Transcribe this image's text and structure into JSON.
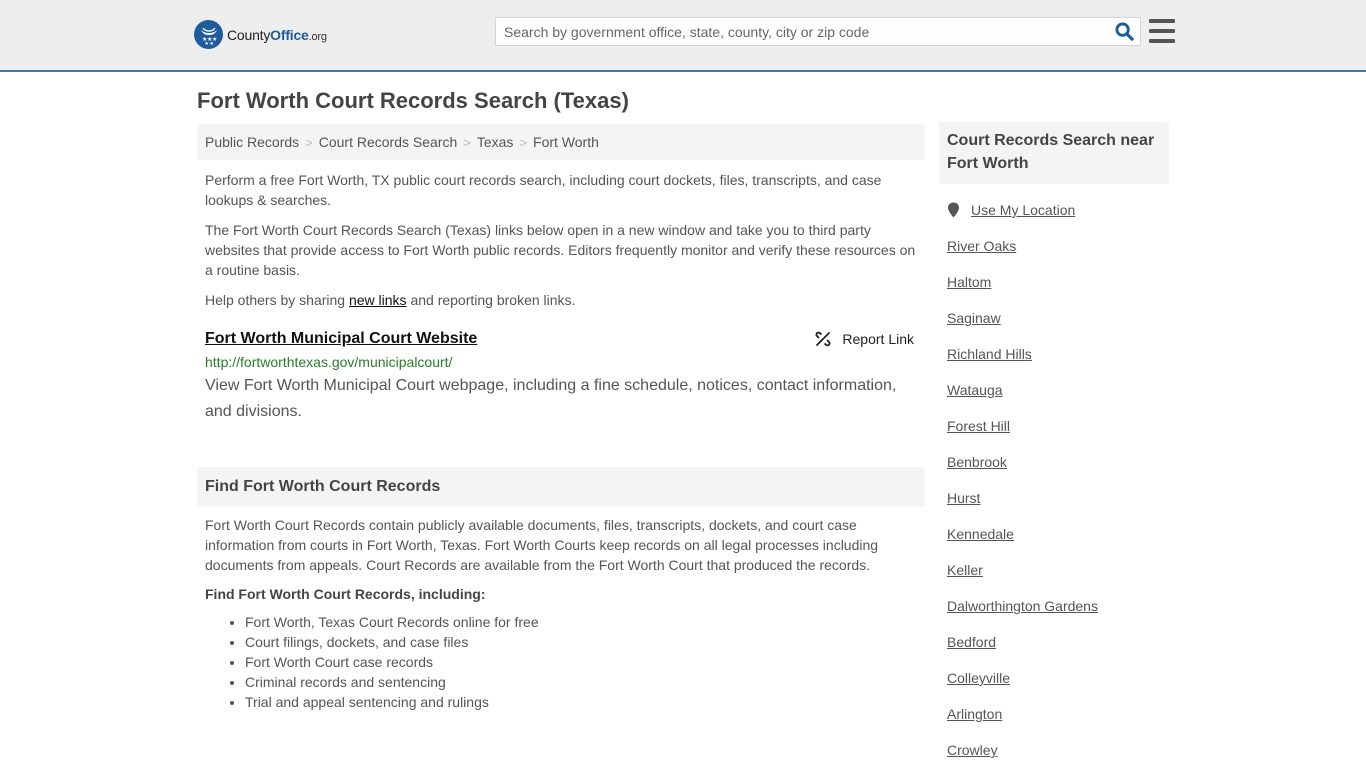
{
  "header": {
    "logo": {
      "name": "County",
      "name_bold": "Office",
      "tld": ".org"
    },
    "search": {
      "placeholder": "Search by government office, state, county, city or zip code",
      "value": ""
    },
    "icons": {
      "search": "search-icon",
      "menu": "hamburger-menu-icon",
      "logo": "eagle-stars-logo-icon"
    },
    "colors": {
      "brand": "#1f5c9e",
      "accent_border": "#337ab7"
    }
  },
  "page": {
    "title": "Fort Worth Court Records Search (Texas)"
  },
  "breadcrumb": [
    {
      "label": "Public Records"
    },
    {
      "label": "Court Records Search"
    },
    {
      "label": "Texas"
    },
    {
      "label": "Fort Worth"
    }
  ],
  "breadcrumb_separator": ">",
  "intro": {
    "p1": "Perform a free Fort Worth, TX public court records search, including court dockets, files, transcripts, and case lookups & searches.",
    "p2": "The Fort Worth Court Records Search (Texas) links below open in a new window and take you to third party websites that provide access to Fort Worth public records. Editors frequently monitor and verify these resources on a routine basis.",
    "p3_before": "Help others by sharing ",
    "p3_link": "new links",
    "p3_after": " and reporting broken links."
  },
  "resource": {
    "title": "Fort Worth Municipal Court Website",
    "url": "http://fortworthtexas.gov/municipalcourt/",
    "description": "View Fort Worth Municipal Court webpage, including a fine schedule, notices, contact information, and divisions.",
    "report_label": "Report Link",
    "report_icon": "broken-link-icon",
    "url_color": "#2a7d2a"
  },
  "find_section": {
    "heading": "Find Fort Worth Court Records",
    "body": "Fort Worth Court Records contain publicly available documents, files, transcripts, dockets, and court case information from courts in Fort Worth, Texas. Fort Worth Courts keep records on all legal processes including documents from appeals. Court Records are available from the Fort Worth Court that produced the records.",
    "subheading": "Find Fort Worth Court Records, including:",
    "bullets": [
      "Fort Worth, Texas Court Records online for free",
      "Court filings, dockets, and case files",
      "Fort Worth Court case records",
      "Criminal records and sentencing",
      "Trial and appeal sentencing and rulings"
    ]
  },
  "sidebar": {
    "heading": "Court Records Search near Fort Worth",
    "use_location": "Use My Location",
    "location_icon": "map-pin-icon",
    "cities": [
      "River Oaks",
      "Haltom",
      "Saginaw",
      "Richland Hills",
      "Watauga",
      "Forest Hill",
      "Benbrook",
      "Hurst",
      "Kennedale",
      "Keller",
      "Dalworthington Gardens",
      "Bedford",
      "Colleyville",
      "Arlington",
      "Crowley"
    ]
  }
}
